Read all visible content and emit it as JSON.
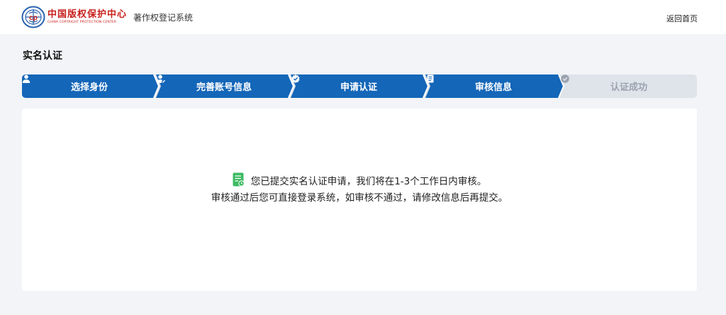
{
  "header": {
    "logo_cn": "中国版权保护中心",
    "logo_en": "CHINA COPYRIGHT PROTECTION CENTER",
    "system_name": "著作权登记系统",
    "back_home": "返回首页"
  },
  "page": {
    "title": "实名认证"
  },
  "steps": [
    {
      "label": "选择身份",
      "icon": "user-icon",
      "status": "done"
    },
    {
      "label": "完善账号信息",
      "icon": "user-edit-icon",
      "status": "done"
    },
    {
      "label": "申请认证",
      "icon": "badge-check-icon",
      "status": "done"
    },
    {
      "label": "审核信息",
      "icon": "document-icon",
      "status": "current"
    },
    {
      "label": "认证成功",
      "icon": "check-circle-icon",
      "status": "pending"
    }
  ],
  "message": {
    "line1": "您已提交实名认证申请，我们将在1-3个工作日内审核。",
    "line2": "审核通过后您可直接登录系统，如审核不通过，请修改信息后再提交。",
    "icon": "review-document-icon"
  },
  "colors": {
    "primary": "#1466b8",
    "logo_red": "#c8201d",
    "inactive_step": "#dfe3ea",
    "inactive_text": "#9aa3ae",
    "success_green": "#3dbb63"
  }
}
